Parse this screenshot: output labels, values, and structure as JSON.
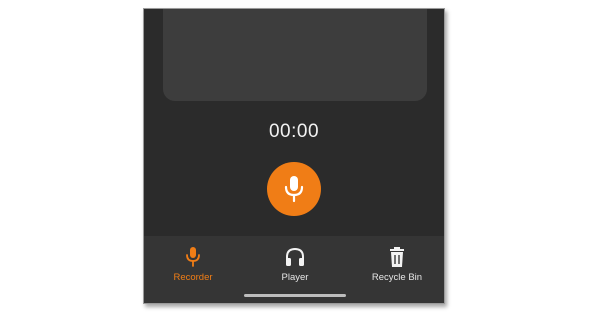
{
  "recorder": {
    "timer": "00:00"
  },
  "nav": {
    "items": [
      {
        "label": "Recorder",
        "icon": "microphone-icon",
        "active": true
      },
      {
        "label": "Player",
        "icon": "headphones-icon",
        "active": false
      },
      {
        "label": "Recycle Bin",
        "icon": "trash-icon",
        "active": false
      }
    ]
  },
  "colors": {
    "accent": "#f07d16",
    "background": "#2b2b2b",
    "panel": "#3d3d3d",
    "bottom_bar": "#353535"
  }
}
